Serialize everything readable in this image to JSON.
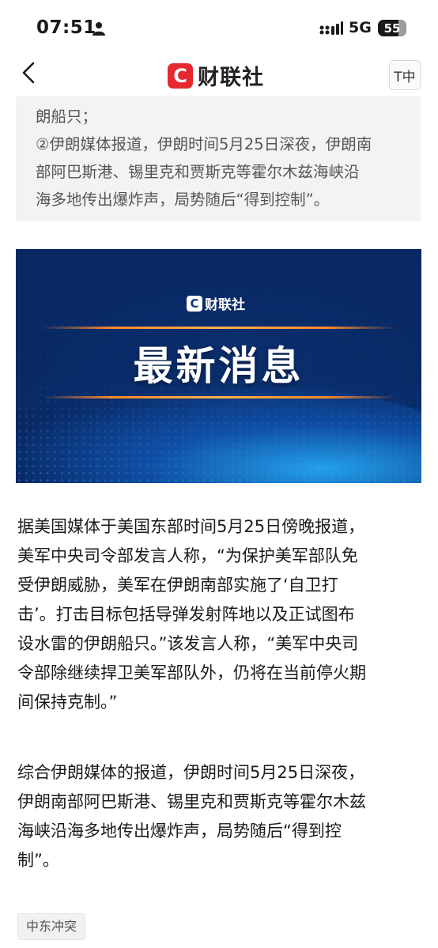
{
  "status_bar": {
    "time": "07:51",
    "network": "5G",
    "battery": "55"
  },
  "nav": {
    "brand_logo": "C",
    "brand_name": "财联社",
    "font_button": "T中"
  },
  "summary": {
    "lines": [
      "朗船只；",
      "②伊朗媒体报道，伊朗时间5月25日深夜，伊朗南",
      "部阿巴斯港、锡里克和贾斯克等霍尔木兹海峡沿",
      "海多地传出爆炸声，局势随后“得到控制”。"
    ]
  },
  "banner": {
    "logo_mark": "C",
    "logo_text": "财联社",
    "title": "最新消息"
  },
  "article": {
    "paragraph1": [
      "据美国媒体于美国东部时间5月25日傍晚报道，",
      "美军中央司令部发言人称，“为保护美军部队免",
      "受伊朗威胁，美军在伊朗南部实施了‘自卫打",
      "击’。打击目标包括导弹发射阵地以及正试图布",
      "设水雷的伊朗船只。”该发言人称，“美军中央司",
      "令部除继续捍卫美军部队外，仍将在当前停火期",
      "间保持克制。”"
    ],
    "paragraph2": [
      "综合伊朗媒体的报道，伊朗时间5月25日深夜，",
      "伊朗南部阿巴斯港、锡里克和贾斯克等霍尔木兹",
      "海峡沿海多地传出爆炸声，局势随后“得到控",
      "制”。"
    ]
  },
  "tags": [
    "中东冲突"
  ],
  "colors": {
    "brand_red": "#e5292f",
    "banner_blue": "#0d3a80",
    "accent_orange": "#ff8a2a"
  }
}
